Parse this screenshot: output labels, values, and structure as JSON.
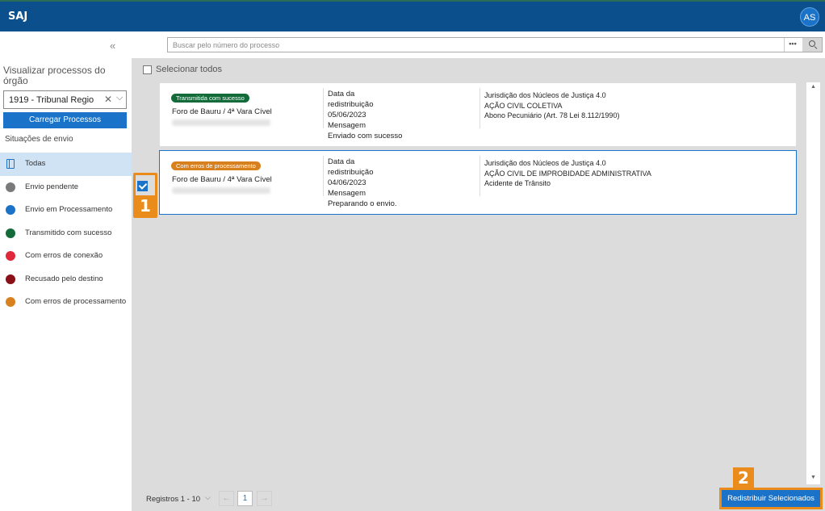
{
  "app": {
    "title": "SAJ",
    "user_initials": "AS"
  },
  "sidebar": {
    "collapse_glyph": "«",
    "view_label": "Visualizar processos do órgão",
    "org_select": {
      "value": "1919 - Tribunal Regio",
      "clear_glyph": "✕",
      "open_glyph": "⌵"
    },
    "load_button": "Carregar Processos",
    "status_title": "Situações de envio",
    "statuses": [
      {
        "label": "Todas",
        "color": "#1a73c8",
        "icon": "book-icon",
        "active": true
      },
      {
        "label": "Envio pendente",
        "color": "#7a7a7a"
      },
      {
        "label": "Envio em Processamento",
        "color": "#1a73c8"
      },
      {
        "label": "Transmitido com sucesso",
        "color": "#146b3a"
      },
      {
        "label": "Com erros de conexão",
        "color": "#e0283a"
      },
      {
        "label": "Recusado pelo destino",
        "color": "#8b0f16"
      },
      {
        "label": "Com erros de processamento",
        "color": "#d9801e"
      }
    ]
  },
  "search": {
    "placeholder": "Buscar pelo número do processo",
    "more_glyph": "•••"
  },
  "list": {
    "select_all_label": "Selecionar todos",
    "items": [
      {
        "badge": "Transmitida com sucesso",
        "badge_color": "#146b3a",
        "foro": "Foro de Bauru / 4ª Vara Cível",
        "date_label_1": "Data da",
        "date_label_2": "redistribuição",
        "date": "05/06/2023",
        "message_label": "Mensagem",
        "message": "Enviado com sucesso",
        "jurisdicao": "Jurisdição dos Núcleos de Justiça 4.0",
        "classe": "AÇÃO CIVIL COLETIVA",
        "assunto": "Abono Pecuniário (Art. 78 Lei 8.112/1990)",
        "selected": false
      },
      {
        "badge": "Com erros de processamento",
        "badge_color": "#d9801e",
        "foro": "Foro de Bauru / 4ª Vara Cível",
        "date_label_1": "Data da",
        "date_label_2": "redistribuição",
        "date": "04/06/2023",
        "message_label": "Mensagem",
        "message": "Preparando o envio.",
        "jurisdicao": "Jurisdição dos Núcleos de Justiça 4.0",
        "classe": "AÇÃO CIVIL DE IMPROBIDADE ADMINISTRATIVA",
        "assunto": "Acidente de Trânsito",
        "selected": true
      }
    ]
  },
  "pagination": {
    "records_label": "Registros 1 - 10",
    "current_page": "1",
    "prev_glyph": "←",
    "next_glyph": "→",
    "chev_glyph": "⌵"
  },
  "scroll": {
    "up_glyph": "▲",
    "down_glyph": "▼"
  },
  "actions": {
    "redistribute_button": "Redistribuir Selecionados"
  },
  "annotations": {
    "step1": "1",
    "step2": "2",
    "highlight_color": "#e98c1c"
  }
}
